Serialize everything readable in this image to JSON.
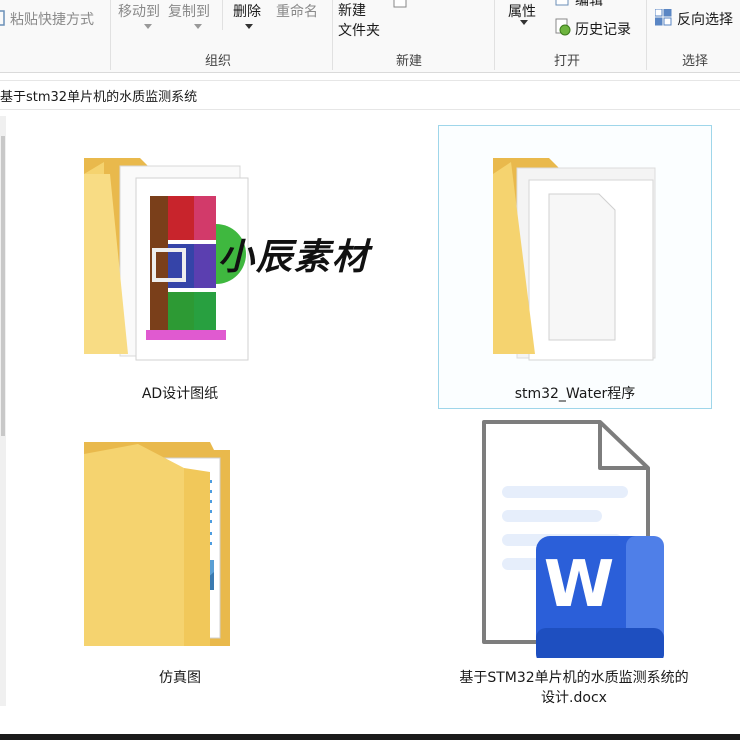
{
  "ribbon": {
    "clipboard": {
      "paste_shortcut": "粘贴快捷方式"
    },
    "organize": {
      "move_to": "移动到",
      "copy_to": "复制到",
      "delete": "删除",
      "rename": "重命名",
      "group_label": "组织"
    },
    "new": {
      "new_folder": "新建\n文件夹",
      "group_label": "新建"
    },
    "open": {
      "properties": "属性",
      "edit": "编辑",
      "history": "历史记录",
      "group_label": "打开"
    },
    "select": {
      "invert": "反向选择",
      "group_label": "选择"
    }
  },
  "address": {
    "path": "基于stm32单片机的水质监测系统"
  },
  "watermark": "小辰素材",
  "items": [
    {
      "name": "AD设计图纸",
      "icon": "rar-folder-icon"
    },
    {
      "name": "stm32_Water程序",
      "icon": "folder-icon",
      "selected": true
    },
    {
      "name": "仿真图",
      "icon": "folder-icon"
    },
    {
      "name": "基于STM32单片机的水质监测系统的\n设计.docx",
      "icon": "word-doc-icon"
    }
  ],
  "colors": {
    "folder": "#f5d36f",
    "folder_dark": "#e9b94c",
    "word_blue": "#2b5fd9",
    "selection": "#9fd6ea"
  }
}
